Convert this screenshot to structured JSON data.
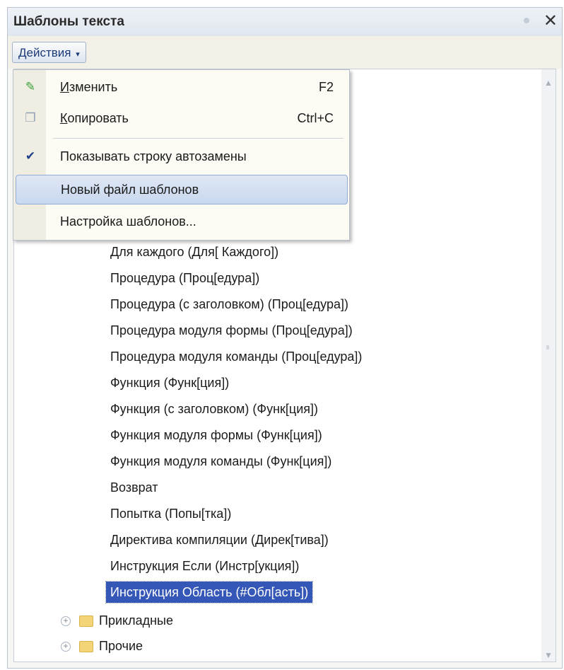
{
  "window": {
    "title": "Шаблоны текста"
  },
  "toolbar": {
    "actions_label": "Действия",
    "actions_arrow": "▾"
  },
  "menu": {
    "items": [
      {
        "label_first": "И",
        "label_rest": "зменить",
        "shortcut": "F2",
        "icon": "pencil-icon"
      },
      {
        "label_first": "К",
        "label_rest": "опировать",
        "shortcut": "Ctrl+C",
        "icon": "copy-icon"
      },
      {
        "label": "Показывать строку автозамены",
        "checked": true,
        "icon": "checkmark-icon"
      },
      {
        "label": "Новый файл шаблонов"
      },
      {
        "label": "Настройка шаблонов..."
      }
    ]
  },
  "tree": {
    "items": [
      "Для каждого (Для[ Каждого])",
      "Процедура (Проц[едура])",
      "Процедура (с заголовком) (Проц[едура])",
      "Процедура модуля формы (Проц[едура])",
      "Процедура модуля команды (Проц[едура])",
      "Функция (Функ[ция])",
      "Функция (с заголовком) (Функ[ция])",
      "Функция модуля формы (Функ[ция])",
      "Функция модуля команды (Функ[ция])",
      "Возврат",
      "Попытка (Попы[тка])",
      "Директива компиляции (Дирек[тива])",
      "Инструкция Если (Инстр[укция])",
      "Инструкция Область (#Обл[асть])"
    ],
    "folders": [
      "Прикладные",
      "Прочие"
    ]
  }
}
